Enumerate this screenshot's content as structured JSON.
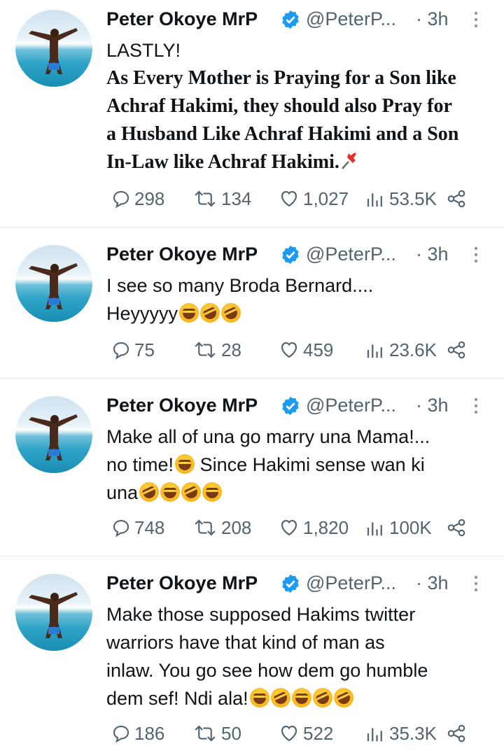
{
  "tweets": [
    {
      "name": "Peter Okoye MrP",
      "handle": "@PeterP...",
      "time": "· 3h",
      "text_lines": [
        "LASTLY!"
      ],
      "text_serif_lines": [
        "As Every Mother is Praying for a Son like",
        "Achraf Hakimi, they should also Pray for",
        "a Husband Like Achraf Hakimi and a Son",
        "In-Law like Achraf Hakimi."
      ],
      "replies": "298",
      "retweets": "134",
      "likes": "1,027",
      "views": "53.5K"
    },
    {
      "name": "Peter Okoye MrP",
      "handle": "@PeterP...",
      "time": "· 3h",
      "text_lines": [
        "I see so many Broda Bernard....",
        "Heyyyyy"
      ],
      "replies": "75",
      "retweets": "28",
      "likes": "459",
      "views": "23.6K"
    },
    {
      "name": "Peter Okoye MrP",
      "handle": "@PeterP...",
      "time": "· 3h",
      "text_lines": [
        "Make all of una go marry una Mama!...",
        "no time!",
        "Since Hakimi sense wan ki",
        "una"
      ],
      "replies": "748",
      "retweets": "208",
      "likes": "1,820",
      "views": "100K"
    },
    {
      "name": "Peter Okoye MrP",
      "handle": "@PeterP...",
      "time": "· 3h",
      "text_lines": [
        "Make those supposed Hakims twitter",
        "warriors have that kind of man as",
        "inlaw. You go see how dem go humble",
        "dem sef! Ndi ala!"
      ],
      "replies": "186",
      "retweets": "50",
      "likes": "522",
      "views": "35.3K"
    }
  ],
  "colors": {
    "text": "#0f1419",
    "muted": "#536471",
    "verified": "#1d9bf0",
    "divider": "#e6e9eb"
  },
  "icons": [
    "reply-icon",
    "retweet-icon",
    "like-icon",
    "views-icon",
    "share-icon",
    "verified-badge-icon",
    "more-options-icon",
    "pushpin-icon",
    "laughing-emoji",
    "rofl-emoji"
  ]
}
